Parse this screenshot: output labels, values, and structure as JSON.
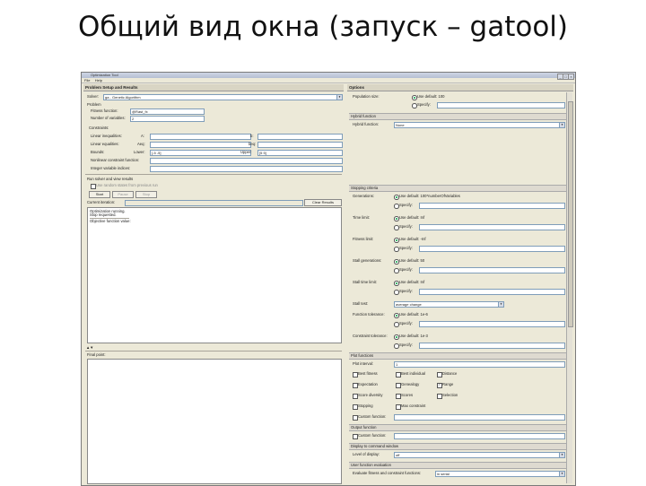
{
  "slide": {
    "title": "Общий вид окна (запуск – gatool)"
  },
  "window": {
    "title": "Optimization Tool",
    "menu": [
      "File",
      "Help"
    ]
  },
  "left": {
    "header": "Problem Setup and Results",
    "solver_label": "Solver:",
    "solver_value": "ga - Genetic Algorithm",
    "problem_label": "Problem",
    "fitness_label": "Fitness function:",
    "fitness_value": "@Rast_fx",
    "numvars_label": "Number of variables:",
    "numvars_value": "2",
    "constraints_label": "Constraints:",
    "lin_ineq_label": "Linear inequalities:",
    "A_label": "A:",
    "b_label": "b:",
    "lin_eq_label": "Linear equalities:",
    "Aeq_label": "Aeq:",
    "beq_label": "beq:",
    "bounds_label": "Bounds:",
    "lower_label": "Lower:",
    "lower_value": "[-5 -5]",
    "upper_label": "Upper:",
    "upper_value": "[5 5]",
    "nonlin_label": "Nonlinear constraint function:",
    "integer_label": "Integer variable indices:",
    "run_label": "Run solver and view results",
    "use_random_label": "Use random states from previous run",
    "start_label": "Start",
    "pause_label": "Pause",
    "stop_label": "Stop",
    "current_iter_label": "Current iteration:",
    "clear_label": "Clear Results",
    "results_lines": [
      "Optimization running.",
      "Stop requested.",
      "Objective function value:"
    ],
    "final_point_label": "Final point:"
  },
  "right": {
    "header": "Options",
    "pop_size_label": "Population size:",
    "pop_size_default": "Use default: 100",
    "specify_label": "Specify:",
    "hybrid_group": "Hybrid function",
    "hybrid_label": "Hybrid function:",
    "hybrid_value": "None",
    "stopping_group": "Stopping criteria",
    "generations_label": "Generations:",
    "generations_default": "Use default: 100*numberOfVariables",
    "time_limit_label": "Time limit:",
    "time_limit_default": "Use default: Inf",
    "fitness_limit_label": "Fitness limit:",
    "fitness_limit_default": "Use default: -Inf",
    "stall_gen_label": "Stall generations:",
    "stall_gen_default": "Use default: 50",
    "stall_time_label": "Stall time limit:",
    "stall_time_default": "Use default: Inf",
    "stall_test_label": "Stall test:",
    "stall_test_value": "average change",
    "func_tol_label": "Function tolerance:",
    "func_tol_default": "Use default: 1e-6",
    "con_tol_label": "Constraint tolerance:",
    "con_tol_default": "Use default: 1e-3",
    "plot_group": "Plot functions",
    "plot_interval_label": "Plot interval:",
    "plot_interval_value": "1",
    "plots": [
      "Best fitness",
      "Best individual",
      "Distance",
      "Expectation",
      "Genealogy",
      "Range",
      "Score diversity",
      "Scores",
      "Selection",
      "Stopping",
      "Max constraint"
    ],
    "custom_func_label": "Custom function:",
    "output_group": "Output function",
    "custom_out_label": "Custom function:",
    "display_group": "Display to command window",
    "level_label": "Level of display:",
    "level_value": "off",
    "vectorize_group": "User function evaluation",
    "evaluate_label": "Evaluate fitness and constraint functions:",
    "evaluate_value": "in serial"
  }
}
